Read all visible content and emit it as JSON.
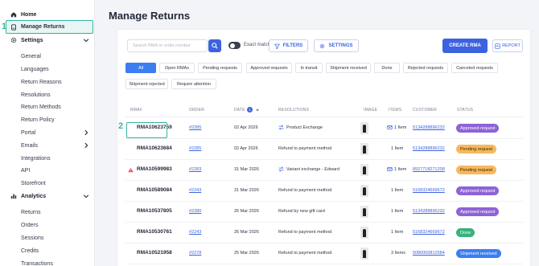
{
  "sidebar": {
    "items": [
      {
        "label": "Home",
        "icon": "home-icon",
        "type": "section"
      },
      {
        "label": "Manage Returns",
        "icon": "returns-icon",
        "type": "active"
      },
      {
        "label": "Settings",
        "icon": "gear-icon",
        "type": "section",
        "chevron": "down"
      },
      {
        "label": "General",
        "type": "sub"
      },
      {
        "label": "Languages",
        "type": "sub"
      },
      {
        "label": "Return Reasons",
        "type": "sub"
      },
      {
        "label": "Resolutions",
        "type": "sub"
      },
      {
        "label": "Return Methods",
        "type": "sub"
      },
      {
        "label": "Return Policy",
        "type": "sub"
      },
      {
        "label": "Portal",
        "type": "sub",
        "chevron": "right"
      },
      {
        "label": "Emails",
        "type": "sub",
        "chevron": "right"
      },
      {
        "label": "Integrations",
        "type": "sub"
      },
      {
        "label": "API",
        "type": "sub"
      },
      {
        "label": "Storefront",
        "type": "sub"
      },
      {
        "label": "Analytics",
        "icon": "chart-icon",
        "type": "section",
        "chevron": "down"
      },
      {
        "label": "Returns",
        "type": "sub"
      },
      {
        "label": "Orders",
        "type": "sub"
      },
      {
        "label": "Sessions",
        "type": "sub"
      },
      {
        "label": "Credits",
        "type": "sub"
      },
      {
        "label": "Transactions",
        "type": "sub"
      }
    ]
  },
  "annotations": {
    "step1": "1",
    "step2": "2"
  },
  "header": {
    "title": "Manage Returns"
  },
  "toolbar": {
    "search_placeholder": "Search RMA or order number",
    "exact_match_label": "Exact match",
    "filters_label": "FILTERS",
    "settings_label": "SETTINGS",
    "create_label": "CREATE RMA",
    "report_label": "REPORT"
  },
  "filters": [
    "All",
    "Open RMAs",
    "Pending requests",
    "Approved requests",
    "In transit",
    "Shipment received",
    "Done",
    "Rejected requests",
    "Canceled requests",
    "Shipment rejected",
    "Require attention"
  ],
  "table": {
    "headers": [
      "RMA#",
      "ORDER",
      "DATE",
      "RESOLUTIONS",
      "IMAGE",
      "ITEMS",
      "CUSTOMER",
      "STATUS"
    ],
    "date_sort_badge": "1",
    "rows": [
      {
        "rma": "RMA10623759",
        "order": "#2285",
        "date": "02 Apr 2026",
        "resolution": "Product Exchange",
        "items": "1 Item",
        "customer": "5134288896232",
        "status": "Approved request",
        "exchange": true,
        "items_icon": true
      },
      {
        "rma": "RMA10623684",
        "order": "#2285",
        "date": "02 Apr 2026",
        "resolution": "Refund to payment method",
        "items": "1 Item",
        "customer": "5134288896232",
        "status": "Pending request"
      },
      {
        "rma": "RMA10599983",
        "order": "#2283",
        "date": "31 Mar 2026",
        "resolution": "Variant exchange - Edward",
        "items": "1 Item",
        "customer": "8927718271208",
        "status": "Pending request",
        "exchange": true,
        "items_icon": true,
        "warning": true
      },
      {
        "rma": "RMA10589084",
        "order": "#2243",
        "date": "31 Mar 2026",
        "resolution": "Refund to payment method",
        "items": "1 Item",
        "customer": "5168324669672",
        "status": "Approved request"
      },
      {
        "rma": "RMA10537805",
        "order": "#2280",
        "date": "26 Mar 2026",
        "resolution": "Refund by new gift card",
        "items": "1 Item",
        "customer": "5134288896232",
        "status": "Approved request"
      },
      {
        "rma": "RMA10530761",
        "order": "#2243",
        "date": "26 Mar 2026",
        "resolution": "Refund to payment method",
        "items": "1 Item",
        "customer": "5168324669672",
        "status": "Done"
      },
      {
        "rma": "RMA10521958",
        "order": "#2278",
        "date": "25 Mar 2026",
        "resolution": "Refund to payment method",
        "items": "3 Items",
        "customer": "5080000812584",
        "status": "Shipment received"
      }
    ]
  },
  "status_colors": {
    "Approved request": {
      "bg": "#8e63d6",
      "fg": "#ffffff"
    },
    "Pending request": {
      "bg": "#f7b85c",
      "fg": "#3a2a10"
    },
    "Done": {
      "bg": "#35b37a",
      "fg": "#ffffff"
    },
    "Shipment received": {
      "bg": "#3b7ef0",
      "fg": "#ffffff"
    }
  },
  "colors": {
    "accent": "#3b63e0",
    "highlight": "#35b3a1"
  }
}
